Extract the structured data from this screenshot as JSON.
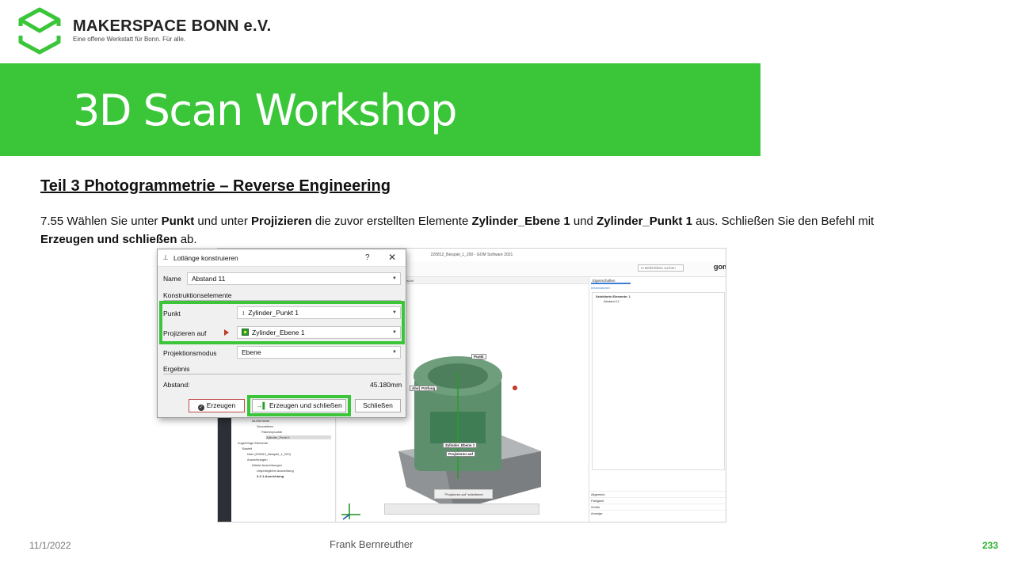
{
  "header": {
    "brand_name": "MAKERSPACE BONN e.V.",
    "brand_tagline": "Eine offene Werkstatt für Bonn. Für alle.",
    "logo_icon": "makerspace-cube-logo",
    "title": "3D Scan Workshop"
  },
  "colors": {
    "accent_green": "#3bc63a",
    "page_number_green": "#2fb32f"
  },
  "slide": {
    "section_heading": "Teil 3 Photogrammetrie – Reverse Engineering",
    "instruction": {
      "prefix": "7.55 Wählen Sie unter ",
      "punkt": "Punkt",
      "und1": " und unter ",
      "projizieren": "Projizieren",
      "mid": " die zuvor erstellten Elemente ",
      "elem1": "Zylinder_Ebene 1",
      "und2": " und ",
      "elem2": "Zylinder_Punkt 1",
      "suffix": " aus. Schließen Sie den Befehl mit ",
      "btn": "Erzeugen und schließen",
      "end": " ab."
    }
  },
  "app": {
    "window_title": "220812_Beispiel_1_200 - GOM Software 2021",
    "search_placeholder": "In Befehlsliste suchen",
    "logo": "gom",
    "alignment_label": "3-2-1-Ausrichtung",
    "viewport_tab": "Ansicht",
    "explorer_items": [
      "Bauteil",
      "Ist-Elemente",
      "Geometrien",
      "Flächenpunkte",
      "Zylinder_Punkt 1",
      "Zugehörige Elemente",
      "Bauteil",
      "Netz (220812_Beispiel_1_200)",
      "Ausrichtungen",
      "Initiale Ausrichtungen",
      "Ursprüngliche Ausrichtung",
      "3-2-1-Ausrichtung"
    ],
    "model_labels": {
      "punkt": "Punkt",
      "zylinder_ebene": "Zylinder_Ebene 1",
      "projizieren_auf": "Projizieren auf",
      "abst": "Abst.",
      "pruefung": "Prüfung"
    },
    "status_chip": "\"Projizieren auf\" selektieren",
    "properties": {
      "tab": "Eigenschaften",
      "info": "Informationen",
      "selected_header": "Selektierte Elemente: 1",
      "selected_item": "Abstand 11",
      "bottom_items": [
        "Allgemein",
        "Fähigkeit",
        "Größe",
        "Anzeige"
      ]
    }
  },
  "dialog": {
    "title": "Lotlänge konstruieren",
    "help": "?",
    "close": "✕",
    "name_label": "Name",
    "name_value": "Abstand 11",
    "section_construction": "Konstruktionselemente",
    "punkt_label": "Punkt",
    "punkt_value": "Zylinder_Punkt 1",
    "projizieren_label": "Projizieren auf",
    "projizieren_value": "Zylinder_Ebene 1",
    "modus_label": "Projektionsmodus",
    "modus_value": "Ebene",
    "section_result": "Ergebnis",
    "abstand_label": "Abstand:",
    "abstand_value": "45.180mm",
    "btn_erzeugen": "Erzeugen",
    "btn_erzeugen_schliessen": "Erzeugen und schließen",
    "btn_schliessen": "Schließen"
  },
  "footer": {
    "date": "11/1/2022",
    "author": "Frank Bernreuther",
    "page": "233"
  }
}
